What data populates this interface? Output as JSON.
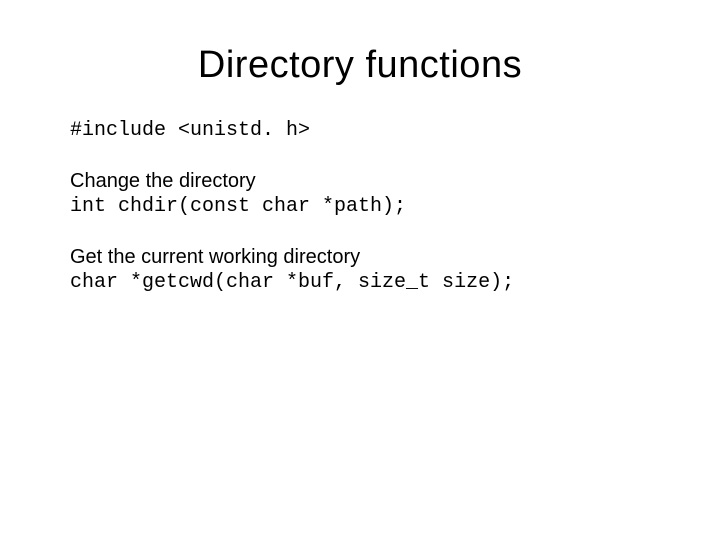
{
  "title": "Directory functions",
  "include_line": "#include <unistd. h>",
  "section1": {
    "label": "Change the directory",
    "code": "int chdir(const char *path);"
  },
  "section2": {
    "label": "Get the current working directory",
    "code": "char *getcwd(char *buf, size_t size);"
  }
}
